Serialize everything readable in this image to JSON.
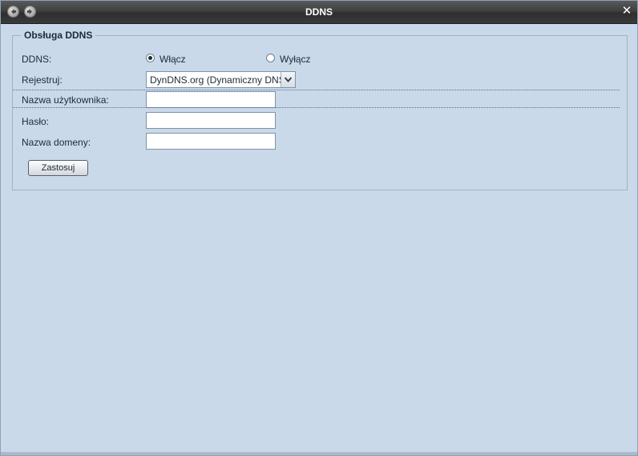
{
  "window": {
    "title": "DDNS",
    "back_icon": "back-arrow-icon",
    "forward_icon": "forward-arrow-icon",
    "close_icon": "close-x-icon",
    "close_glyph": "✕"
  },
  "form": {
    "legend": "Obsługa DDNS",
    "ddns": {
      "label": "DDNS:",
      "options": [
        {
          "label": "Włącz",
          "checked": true
        },
        {
          "label": "Wyłącz",
          "checked": false
        }
      ]
    },
    "register": {
      "label": "Rejestruj:",
      "selected": "DynDNS.org (Dynamiczny DNS)"
    },
    "username": {
      "label": "Nazwa użytkownika:",
      "value": ""
    },
    "password": {
      "label": "Hasło:",
      "value": ""
    },
    "domain": {
      "label": "Nazwa domeny:",
      "value": ""
    },
    "apply_label": "Zastosuj"
  },
  "colors": {
    "background": "#c9d9ea",
    "titlebar": "#3f3f3f",
    "title_text": "#ffffff"
  }
}
